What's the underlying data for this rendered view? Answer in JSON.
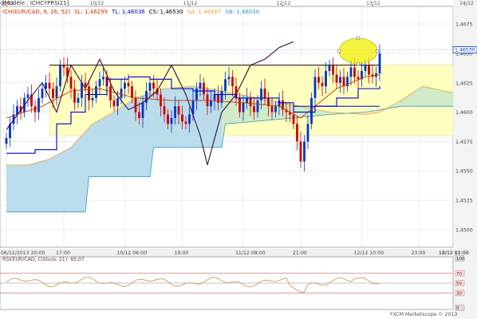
{
  "chart_data": [
    {
      "type": "candlestick",
      "legend": {
        "model_label": "[Modèle : ICHCYPRSI21]",
        "indicator_line": [
          {
            "text": "ICH(EUR/CAD, 9, 26, 52)",
            "color": "#cc3300"
          },
          {
            "text": "SL: 1,46299",
            "color": "#cc3300"
          },
          {
            "text": "TL: 1,46036",
            "color": "#0000cc"
          },
          {
            "text": "CS: 1,46530",
            "color": "#000000"
          },
          {
            "text": "SA: 1,46167",
            "color": "#f0a030"
          },
          {
            "text": "SB: 1,46036",
            "color": "#3399cc"
          }
        ]
      },
      "top_dates": [
        "08/12",
        "10/12",
        "11/12",
        "12/12",
        "13/12",
        "14/12"
      ],
      "x_tick_labels": [
        "06/12/2013 20:00",
        "17:00",
        "10/12 06:00",
        "19:00",
        "11/12 08:00",
        "21:00",
        "12/12 10:00",
        "23:00",
        "13/12 12:00",
        "14/12 01:00"
      ],
      "y_tick_labels": [
        "1,4675",
        "1,4650",
        "1,4625",
        "1,4600",
        "1,4575",
        "1,4550",
        "1,4525",
        "1,4500"
      ],
      "ylim": [
        1.4485,
        1.469
      ],
      "last_price": "1,46530",
      "closes": [
        1.4578,
        1.459,
        1.4598,
        1.4605,
        1.46,
        1.4612,
        1.4615,
        1.4605,
        1.46,
        1.4612,
        1.462,
        1.4625,
        1.462,
        1.4612,
        1.4622,
        1.464,
        1.4638,
        1.463,
        1.462,
        1.4608,
        1.4612,
        1.4625,
        1.4622,
        1.461,
        1.4612,
        1.4622,
        1.4628,
        1.463,
        1.4622,
        1.461,
        1.4605,
        1.4612,
        1.462,
        1.4625,
        1.4622,
        1.4612,
        1.46,
        1.4595,
        1.4608,
        1.4618,
        1.4625,
        1.462,
        1.4615,
        1.4605,
        1.4598,
        1.459,
        1.4595,
        1.4605,
        1.4598,
        1.4592,
        1.459,
        1.4598,
        1.461,
        1.462,
        1.4625,
        1.4615,
        1.4605,
        1.461,
        1.4615,
        1.4608,
        1.4618,
        1.4628,
        1.463,
        1.4622,
        1.4612,
        1.46,
        1.4608,
        1.4612,
        1.4605,
        1.46,
        1.461,
        1.462,
        1.4612,
        1.4605,
        1.46,
        1.4605,
        1.461,
        1.4602,
        1.46,
        1.4598,
        1.459,
        1.4575,
        1.4558,
        1.4575,
        1.459,
        1.4612,
        1.463,
        1.4625,
        1.4622,
        1.4635,
        1.464,
        1.4632,
        1.4625,
        1.463,
        1.4622,
        1.463,
        1.4638,
        1.463,
        1.4628,
        1.4635,
        1.464,
        1.4632,
        1.463,
        1.4633,
        1.465
      ],
      "kijun_points": [
        [
          0,
          1.4565
        ],
        [
          6,
          1.4565
        ],
        [
          8,
          1.4568
        ],
        [
          14,
          1.459
        ],
        [
          18,
          1.46
        ],
        [
          22,
          1.4615
        ],
        [
          28,
          1.4628
        ],
        [
          34,
          1.463
        ],
        [
          40,
          1.4628
        ],
        [
          46,
          1.462
        ],
        [
          52,
          1.4618
        ],
        [
          58,
          1.4615
        ],
        [
          64,
          1.4612
        ],
        [
          70,
          1.4612
        ],
        [
          76,
          1.4608
        ],
        [
          80,
          1.46
        ],
        [
          86,
          1.4605
        ],
        [
          92,
          1.4612
        ],
        [
          98,
          1.462
        ],
        [
          104,
          1.4622
        ]
      ],
      "tenkan_points": [
        [
          0,
          1.4595
        ],
        [
          10,
          1.4605
        ],
        [
          18,
          1.4618
        ],
        [
          26,
          1.462
        ],
        [
          36,
          1.4612
        ],
        [
          46,
          1.461
        ],
        [
          56,
          1.461
        ],
        [
          66,
          1.4608
        ],
        [
          76,
          1.4605
        ],
        [
          82,
          1.4595
        ],
        [
          86,
          1.4605
        ],
        [
          92,
          1.462
        ],
        [
          100,
          1.463
        ],
        [
          104,
          1.4632
        ]
      ],
      "senkou_a_points": [
        [
          0,
          1.4555
        ],
        [
          6,
          1.4555
        ],
        [
          12,
          1.456
        ],
        [
          18,
          1.457
        ],
        [
          24,
          1.459
        ],
        [
          30,
          1.46
        ],
        [
          36,
          1.4612
        ],
        [
          44,
          1.462
        ],
        [
          52,
          1.4622
        ],
        [
          60,
          1.4618
        ],
        [
          70,
          1.4612
        ],
        [
          80,
          1.4606
        ],
        [
          90,
          1.46
        ],
        [
          100,
          1.4598
        ],
        [
          104,
          1.46
        ],
        [
          110,
          1.461
        ],
        [
          116,
          1.4622
        ],
        [
          122,
          1.4618
        ],
        [
          128,
          1.4615
        ]
      ],
      "senkou_b_points": [
        [
          0,
          1.4515
        ],
        [
          22,
          1.4515
        ],
        [
          23,
          1.4545
        ],
        [
          40,
          1.4545
        ],
        [
          41,
          1.457
        ],
        [
          60,
          1.457
        ],
        [
          61,
          1.459
        ],
        [
          80,
          1.4595
        ],
        [
          90,
          1.4598
        ],
        [
          100,
          1.46
        ],
        [
          110,
          1.4605
        ],
        [
          120,
          1.4605
        ],
        [
          128,
          1.4605
        ]
      ],
      "chikou_points": [
        [
          0,
          1.4585
        ],
        [
          6,
          1.461
        ],
        [
          10,
          1.4625
        ],
        [
          14,
          1.46
        ],
        [
          18,
          1.464
        ],
        [
          22,
          1.462
        ],
        [
          26,
          1.4645
        ],
        [
          30,
          1.4618
        ],
        [
          34,
          1.4602
        ],
        [
          38,
          1.4608
        ],
        [
          42,
          1.4618
        ],
        [
          46,
          1.464
        ],
        [
          50,
          1.4615
        ],
        [
          54,
          1.458
        ],
        [
          56,
          1.4555
        ],
        [
          60,
          1.46
        ],
        [
          64,
          1.4615
        ],
        [
          68,
          1.464
        ],
        [
          72,
          1.4645
        ],
        [
          76,
          1.4655
        ],
        [
          80,
          1.466
        ]
      ],
      "annotations": {
        "resistance_level": 1.464,
        "circle_center": [
          98,
          1.4652
        ]
      }
    },
    {
      "type": "line",
      "label": "RSI(EUR/CAD, Clôture, 21): 65,07",
      "y_tick_labels": [
        "100",
        "70",
        "50",
        "30",
        "0"
      ],
      "ylim": [
        0,
        100
      ],
      "levels": [
        70,
        50,
        30
      ]
    }
  ],
  "footer": {
    "text": "FXCM Marketscope © 2013"
  },
  "colors": {
    "bull_candle": "#0033cc",
    "bear_candle": "#cc0000",
    "tenkan": "#cc3300",
    "kijun": "#0000cc",
    "chikou": "#3a0a3a",
    "senkou_a": "#f0a030",
    "senkou_b": "#3399cc",
    "cloud_bull": "#c8e8c8",
    "cloud_bear": "#f7e0c0",
    "highlight_band": "#ffffc0",
    "circle_fill": "#f0f000"
  }
}
